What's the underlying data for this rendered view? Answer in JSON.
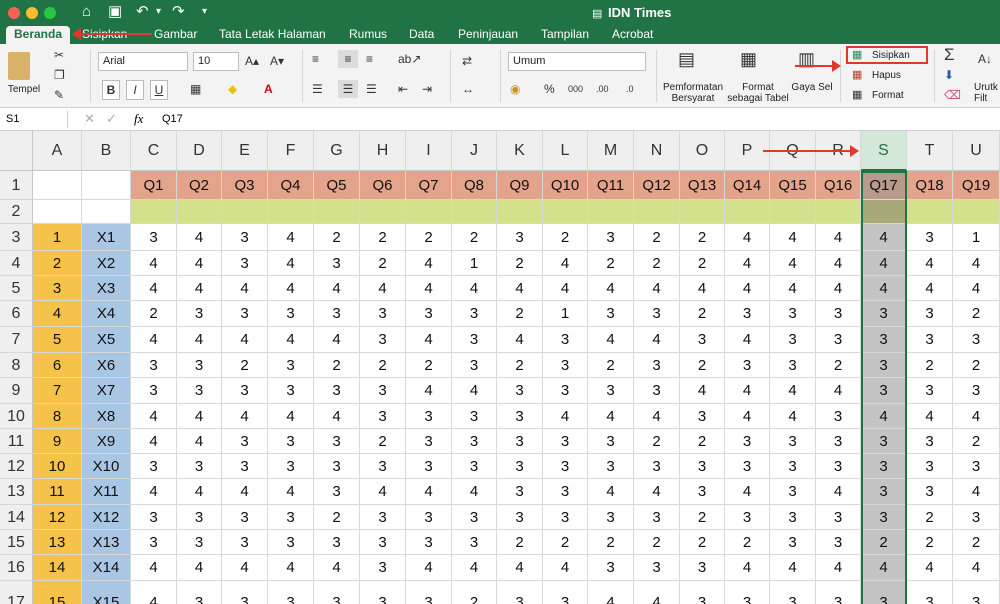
{
  "app_title": "IDN Times",
  "tabs": [
    "Beranda",
    "Sisipkan",
    "Gambar",
    "Tata Letak Halaman",
    "Rumus",
    "Data",
    "Peninjauan",
    "Tampilan",
    "Acrobat"
  ],
  "ribbon": {
    "paste_label": "Tempel",
    "font_name": "Arial",
    "font_size": "10",
    "number_format": "Umum",
    "conditional_format_label": "Pemformatan Bersyarat",
    "format_table_label": "Format sebagai Tabel",
    "cell_style_label": "Gaya Sel",
    "insert_label": "Sisipkan",
    "delete_label": "Hapus",
    "format_label": "Format",
    "sort_label": "Urutk Filt",
    "bold": "B",
    "italic": "I",
    "underline": "U",
    "currency": "%"
  },
  "formula_bar": {
    "name_box": "S1",
    "fx": "fx",
    "content": "Q17"
  },
  "columns": [
    "A",
    "B",
    "C",
    "D",
    "E",
    "F",
    "G",
    "H",
    "I",
    "J",
    "K",
    "L",
    "M",
    "N",
    "O",
    "P",
    "Q",
    "R",
    "S",
    "T",
    "U"
  ],
  "row_numbers": [
    "1",
    "2",
    "3",
    "4",
    "5",
    "6",
    "7",
    "8",
    "9",
    "10",
    "11",
    "12",
    "13",
    "14",
    "15",
    "16",
    "17"
  ],
  "header_row": [
    "Q1",
    "Q2",
    "Q3",
    "Q4",
    "Q5",
    "Q6",
    "Q7",
    "Q8",
    "Q9",
    "Q10",
    "Q11",
    "Q12",
    "Q13",
    "Q14",
    "Q15",
    "Q16",
    "Q17",
    "Q18",
    "Q19"
  ],
  "rows": [
    {
      "n": "1",
      "x": "X1",
      "v": [
        "3",
        "4",
        "3",
        "4",
        "2",
        "2",
        "2",
        "2",
        "3",
        "2",
        "3",
        "2",
        "2",
        "4",
        "4",
        "4",
        "4",
        "3",
        "1"
      ]
    },
    {
      "n": "2",
      "x": "X2",
      "v": [
        "4",
        "4",
        "3",
        "4",
        "3",
        "2",
        "4",
        "1",
        "2",
        "4",
        "2",
        "2",
        "2",
        "4",
        "4",
        "4",
        "4",
        "4",
        "4"
      ]
    },
    {
      "n": "3",
      "x": "X3",
      "v": [
        "4",
        "4",
        "4",
        "4",
        "4",
        "4",
        "4",
        "4",
        "4",
        "4",
        "4",
        "4",
        "4",
        "4",
        "4",
        "4",
        "4",
        "4",
        "4"
      ]
    },
    {
      "n": "4",
      "x": "X4",
      "v": [
        "2",
        "3",
        "3",
        "3",
        "3",
        "3",
        "3",
        "3",
        "2",
        "1",
        "3",
        "3",
        "2",
        "3",
        "3",
        "3",
        "3",
        "3",
        "2"
      ]
    },
    {
      "n": "5",
      "x": "X5",
      "v": [
        "4",
        "4",
        "4",
        "4",
        "4",
        "3",
        "4",
        "3",
        "4",
        "3",
        "4",
        "4",
        "3",
        "4",
        "3",
        "3",
        "3",
        "3",
        "3"
      ]
    },
    {
      "n": "6",
      "x": "X6",
      "v": [
        "3",
        "3",
        "2",
        "3",
        "2",
        "2",
        "2",
        "3",
        "2",
        "3",
        "2",
        "3",
        "2",
        "3",
        "3",
        "2",
        "3",
        "2",
        "2"
      ]
    },
    {
      "n": "7",
      "x": "X7",
      "v": [
        "3",
        "3",
        "3",
        "3",
        "3",
        "3",
        "4",
        "4",
        "3",
        "3",
        "3",
        "3",
        "4",
        "4",
        "4",
        "4",
        "3",
        "3",
        "3"
      ]
    },
    {
      "n": "8",
      "x": "X8",
      "v": [
        "4",
        "4",
        "4",
        "4",
        "4",
        "3",
        "3",
        "3",
        "3",
        "4",
        "4",
        "4",
        "3",
        "4",
        "4",
        "3",
        "4",
        "4",
        "4"
      ]
    },
    {
      "n": "9",
      "x": "X9",
      "v": [
        "4",
        "4",
        "3",
        "3",
        "3",
        "2",
        "3",
        "3",
        "3",
        "3",
        "3",
        "2",
        "2",
        "3",
        "3",
        "3",
        "3",
        "3",
        "2"
      ]
    },
    {
      "n": "10",
      "x": "X10",
      "v": [
        "3",
        "3",
        "3",
        "3",
        "3",
        "3",
        "3",
        "3",
        "3",
        "3",
        "3",
        "3",
        "3",
        "3",
        "3",
        "3",
        "3",
        "3",
        "3"
      ]
    },
    {
      "n": "11",
      "x": "X11",
      "v": [
        "4",
        "4",
        "4",
        "4",
        "3",
        "4",
        "4",
        "4",
        "3",
        "3",
        "4",
        "4",
        "3",
        "4",
        "3",
        "4",
        "3",
        "3",
        "4"
      ]
    },
    {
      "n": "12",
      "x": "X12",
      "v": [
        "3",
        "3",
        "3",
        "3",
        "2",
        "3",
        "3",
        "3",
        "3",
        "3",
        "3",
        "3",
        "2",
        "3",
        "3",
        "3",
        "3",
        "2",
        "3"
      ]
    },
    {
      "n": "13",
      "x": "X13",
      "v": [
        "3",
        "3",
        "3",
        "3",
        "3",
        "3",
        "3",
        "3",
        "2",
        "2",
        "2",
        "2",
        "2",
        "2",
        "3",
        "3",
        "2",
        "2",
        "2"
      ]
    },
    {
      "n": "14",
      "x": "X14",
      "v": [
        "4",
        "4",
        "4",
        "4",
        "4",
        "3",
        "4",
        "4",
        "4",
        "4",
        "3",
        "3",
        "3",
        "4",
        "4",
        "4",
        "4",
        "4",
        "4"
      ]
    },
    {
      "n": "15",
      "x": "X15",
      "v": [
        "4",
        "3",
        "3",
        "3",
        "3",
        "3",
        "3",
        "2",
        "3",
        "3",
        "4",
        "4",
        "3",
        "3",
        "3",
        "3",
        "3",
        "3",
        "3"
      ]
    }
  ],
  "colors": {
    "title_green": "#1f7345",
    "header_salmon": "#e4a48c",
    "row2_green": "#d3e28a",
    "col_a_yellow": "#f5c24a",
    "col_b_blue": "#a9c6e4",
    "selected_col": "#c4c4c4",
    "arrow_red": "#e0392b"
  }
}
